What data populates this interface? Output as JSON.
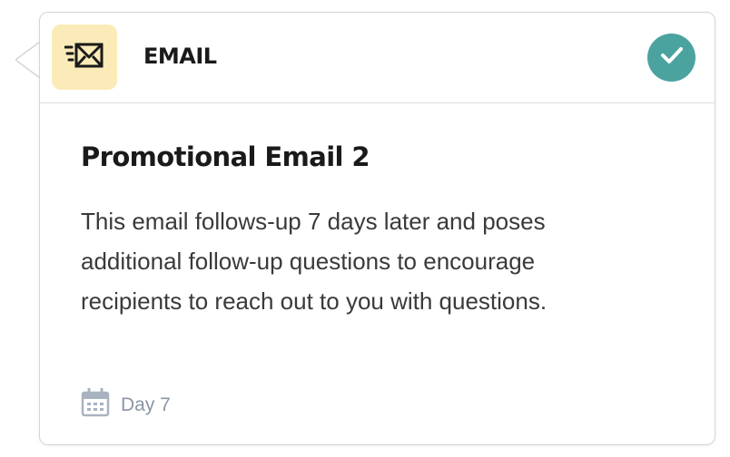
{
  "card": {
    "type_label": "EMAIL",
    "type_icon": "envelope-speed-icon",
    "status_icon": "check-icon",
    "title": "Promotional Email 2",
    "description": "This email follows-up 7 days later and poses additional follow-up questions to encourage recipients to reach out to you with questions.",
    "schedule_icon": "calendar-icon",
    "schedule_label": "Day 7"
  },
  "colors": {
    "icon_tile_bg": "#fbebb8",
    "status_green": "#4ba39f",
    "muted_text": "#8a96a6",
    "title_text": "#1a1a1a"
  }
}
